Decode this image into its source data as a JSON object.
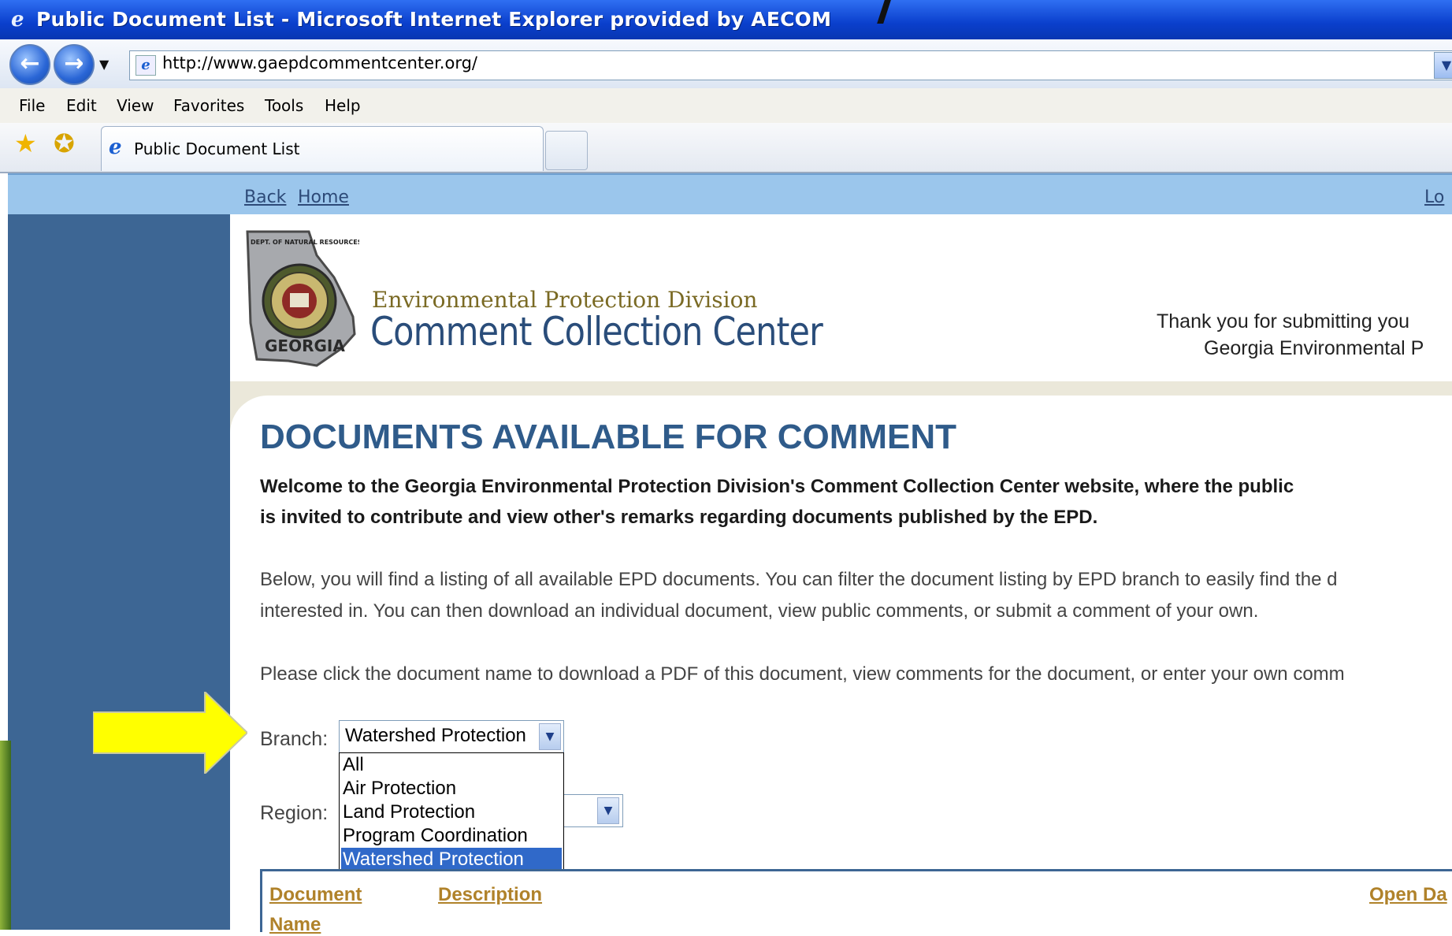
{
  "window": {
    "title": "Public Document List - Microsoft Internet Explorer provided by AECOM"
  },
  "address_bar": {
    "url": "http://www.gaepdcommentcenter.org/"
  },
  "menu": {
    "items": [
      "File",
      "Edit",
      "View",
      "Favorites",
      "Tools",
      "Help"
    ]
  },
  "tabs": {
    "active_label": "Public Document List"
  },
  "site_nav": {
    "back": "Back",
    "home": "Home",
    "right_link_partial": "Lo"
  },
  "header": {
    "seal_text_top": "DEPT. OF NATURAL RESOURCES",
    "seal_text_bottom": "GEORGIA",
    "division": "Environmental Protection Division",
    "title": "Comment Collection Center",
    "thanks_line1": "Thank you for submitting you",
    "thanks_line2": "Georgia Environmental P"
  },
  "content": {
    "heading": "DOCUMENTS AVAILABLE FOR COMMENT",
    "welcome_line1": "Welcome to the Georgia Environmental Protection Division's Comment Collection Center website, where the public",
    "welcome_line2": "is invited to contribute and view other's remarks regarding documents published by the EPD.",
    "below_line1": "Below, you will find a listing of all available EPD documents. You can filter the document listing by EPD branch to easily find the d",
    "below_line2": "interested in. You can then download an individual document, view public comments, or submit a comment of your own.",
    "click_line": "Please click the document name to download a PDF of this document, view comments for the document, or enter your own comm"
  },
  "filters": {
    "branch_label": "Branch:",
    "branch_selected": "Watershed Protection",
    "branch_options": [
      "All",
      "Air Protection",
      "Land Protection",
      "Program Coordination",
      "Watershed Protection"
    ],
    "branch_highlighted_index": 4,
    "region_label": "Region:"
  },
  "table": {
    "col_document_line1": "Document",
    "col_document_line2": "Name",
    "col_description": "Description",
    "col_open_date_partial": "Open Da"
  },
  "colors": {
    "title_bar": "#0a3fcc",
    "site_nav_bg": "#9bc6ec",
    "left_panel": "#3d6694",
    "heading": "#2f5b8a",
    "column_link": "#b0822a",
    "highlight": "#3069c9",
    "arrow": "#ffff00"
  },
  "icons": {
    "back": "back-arrow-icon",
    "forward": "forward-arrow-icon",
    "page": "ie-page-icon",
    "favorites": "favorites-star-icon",
    "add_favorite": "add-favorite-icon",
    "callout": "yellow-arrow-icon"
  }
}
